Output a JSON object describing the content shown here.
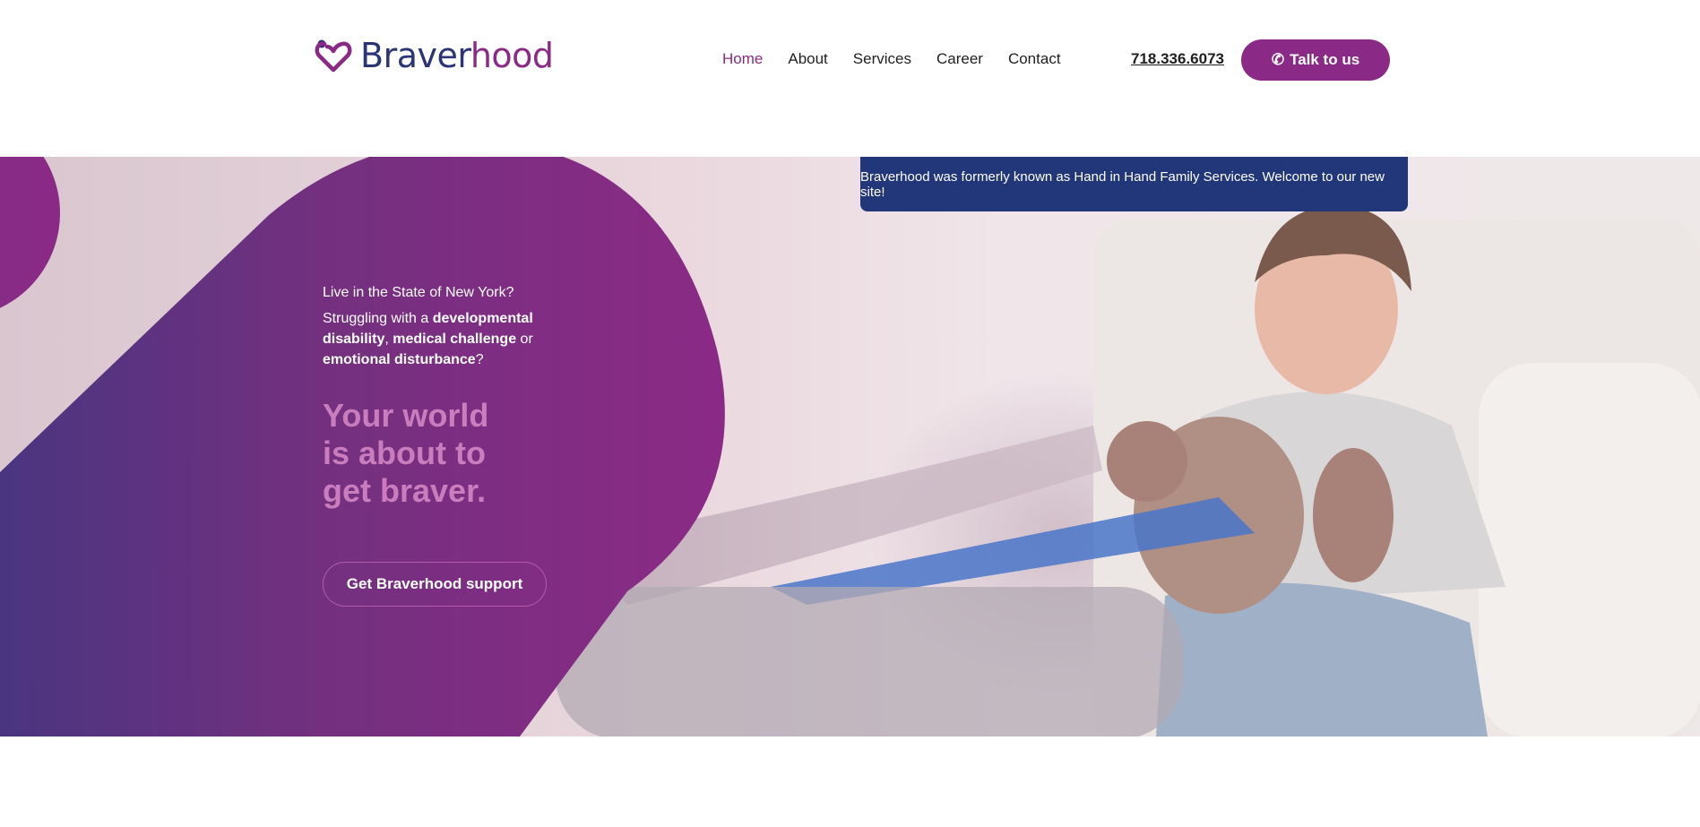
{
  "brand": {
    "name_part1": "Braver",
    "name_part2": "hood",
    "primary_color": "#8b2a86",
    "navy_color": "#22367a"
  },
  "nav": {
    "items": [
      {
        "label": "Home",
        "active": true
      },
      {
        "label": "About",
        "active": false
      },
      {
        "label": "Services",
        "active": false
      },
      {
        "label": "Career",
        "active": false
      },
      {
        "label": "Contact",
        "active": false
      }
    ]
  },
  "header": {
    "phone": "718.336.6073",
    "cta_label": "Talk to us",
    "cta_icon": "phone-icon"
  },
  "banner": {
    "text": "Braverhood was formerly known as Hand in Hand Family Services. Welcome to our new site!"
  },
  "hero": {
    "question1": "Live in the State of New York?",
    "q2_a": "Struggling with a ",
    "q2_b": "developmental disability",
    "q2_c": ", ",
    "q2_d": "medical challenge",
    "q2_e": " or ",
    "q2_f": "emotional disturbance",
    "q2_g": "?",
    "headline_line1": "Your world",
    "headline_line2": "is about to",
    "headline_line3": "get braver.",
    "support_button": "Get Braverhood support"
  }
}
